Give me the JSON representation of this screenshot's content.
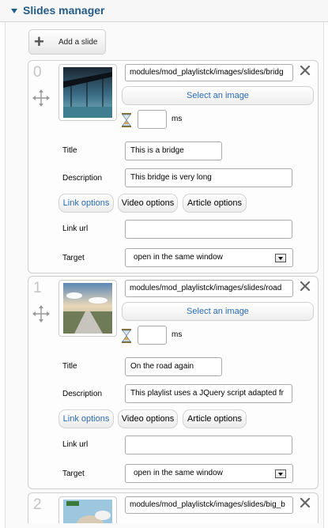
{
  "header": {
    "title": "Slides manager"
  },
  "add_slide": {
    "label": "Add a slide"
  },
  "icons": {
    "collapse": "triangle-down-icon",
    "add": "plus-icon",
    "move": "move-arrows-icon",
    "close": "close-x-icon",
    "duration": "hourglass-icon"
  },
  "labels": {
    "select_image": "Select an image",
    "ms": "ms",
    "title": "Title",
    "description": "Description",
    "link_url": "Link url",
    "target": "Target",
    "tabs": [
      "Link options",
      "Video options",
      "Article options"
    ]
  },
  "slides": [
    {
      "number": "0",
      "image_path": "modules/mod_playlistck/images/slides/bridg",
      "duration": "",
      "title": "This is a bridge",
      "description": "This bridge is very long",
      "active_tab": "Link options",
      "link_url": "",
      "target": "open in the same window"
    },
    {
      "number": "1",
      "image_path": "modules/mod_playlistck/images/slides/road",
      "duration": "",
      "title": "On the road again",
      "description": "This playlist uses a JQuery script adapted fr",
      "active_tab": "Link options",
      "link_url": "",
      "target": "open in the same window"
    },
    {
      "number": "2",
      "image_path": "modules/mod_playlistck/images/slides/big_b"
    }
  ]
}
